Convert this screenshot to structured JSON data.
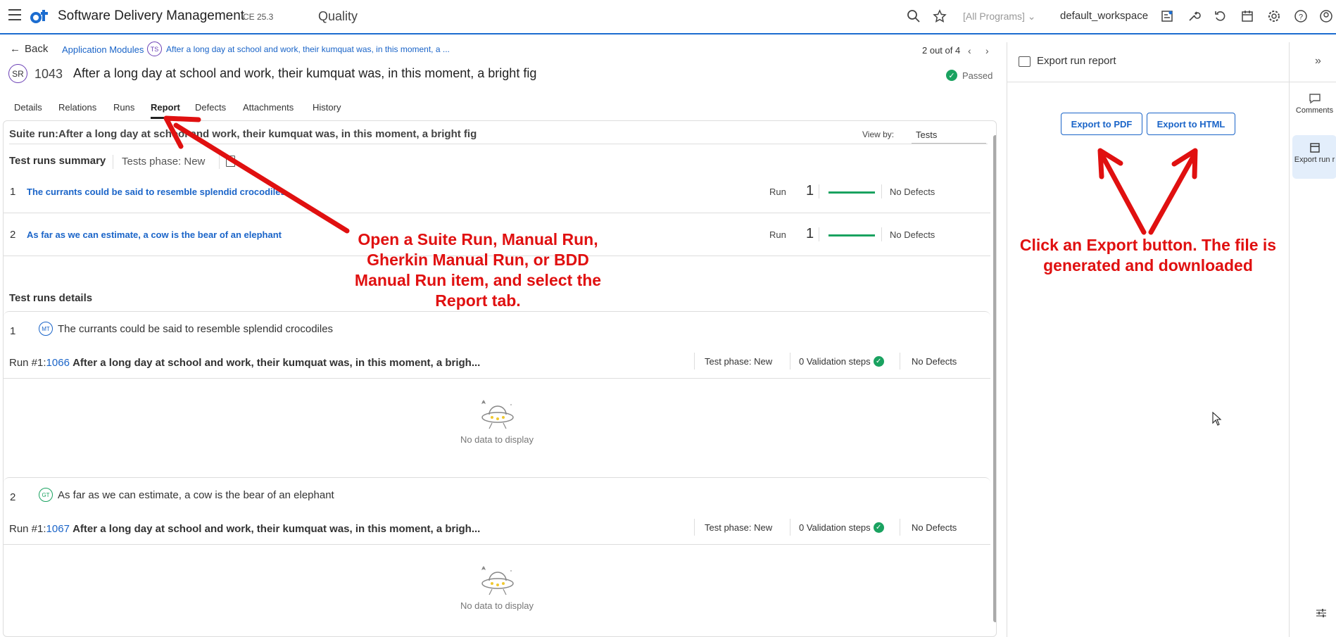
{
  "topbar": {
    "app_title": "Software Delivery Management",
    "version": "CE 25.3",
    "module": "Quality",
    "program_selector": "[All Programs]",
    "workspace": "default_workspace"
  },
  "header": {
    "back_label": "Back",
    "breadcrumb_module": "Application Modules",
    "breadcrumb_badge": "TS",
    "breadcrumb_item": "After a long day at school and work, their kumquat was, in this moment, a ...",
    "pager": "2 out of 4",
    "entity_badge": "SR",
    "item_id": "1043",
    "item_name": "After a long day at school and work, their kumquat was, in this moment, a bright fig",
    "status": "Passed"
  },
  "tabs": [
    "Details",
    "Relations",
    "Runs",
    "Report",
    "Defects",
    "Attachments",
    "History"
  ],
  "report": {
    "suite_title": "Suite run:After a long day at school and work, their kumquat was, in this moment, a bright fig",
    "view_by_label": "View by:",
    "view_by_value": "Tests",
    "summary_title": "Test runs summary",
    "summary_phase": "Tests phase: New",
    "summary_rows": [
      {
        "num": "1",
        "name": "The currants could be said to resemble splendid crocodiles",
        "run_label": "Run",
        "count": "1",
        "defects": "No Defects"
      },
      {
        "num": "2",
        "name": "As far as we can estimate, a cow is the bear of an elephant",
        "run_label": "Run",
        "count": "1",
        "defects": "No Defects"
      }
    ],
    "details_title": "Test runs details",
    "details": [
      {
        "num": "1",
        "badge": "MT",
        "name": "The currants could be said to resemble splendid crocodiles",
        "run_prefix": "Run #1:",
        "run_id": "1066",
        "run_name": "After a long day at school and work, their kumquat was, in this moment, a brigh...",
        "phase": "Test phase: New",
        "steps": "0 Validation steps",
        "defects": "No Defects",
        "empty": "No data to display"
      },
      {
        "num": "2",
        "badge": "GT",
        "name": "As far as we can estimate, a cow is the bear of an elephant",
        "run_prefix": "Run #1:",
        "run_id": "1067",
        "run_name": "After a long day at school and work, their kumquat was, in this moment, a brigh...",
        "phase": "Test phase: New",
        "steps": "0 Validation steps",
        "defects": "No Defects",
        "empty": "No data to display"
      }
    ]
  },
  "panel": {
    "title": "Export run report",
    "export_pdf": "Export to PDF",
    "export_html": "Export to HTML"
  },
  "rail": {
    "comments": "Comments",
    "export": "Export run r"
  },
  "annotations": {
    "left": "Open a Suite Run, Manual Run, Gherkin Manual Run, or BDD Manual Run item, and select the Report tab.",
    "right": "Click an Export button. The file is generated and downloaded"
  },
  "colors": {
    "accent": "#1a64c8",
    "pass": "#1aa260",
    "annotation": "#e01010"
  }
}
